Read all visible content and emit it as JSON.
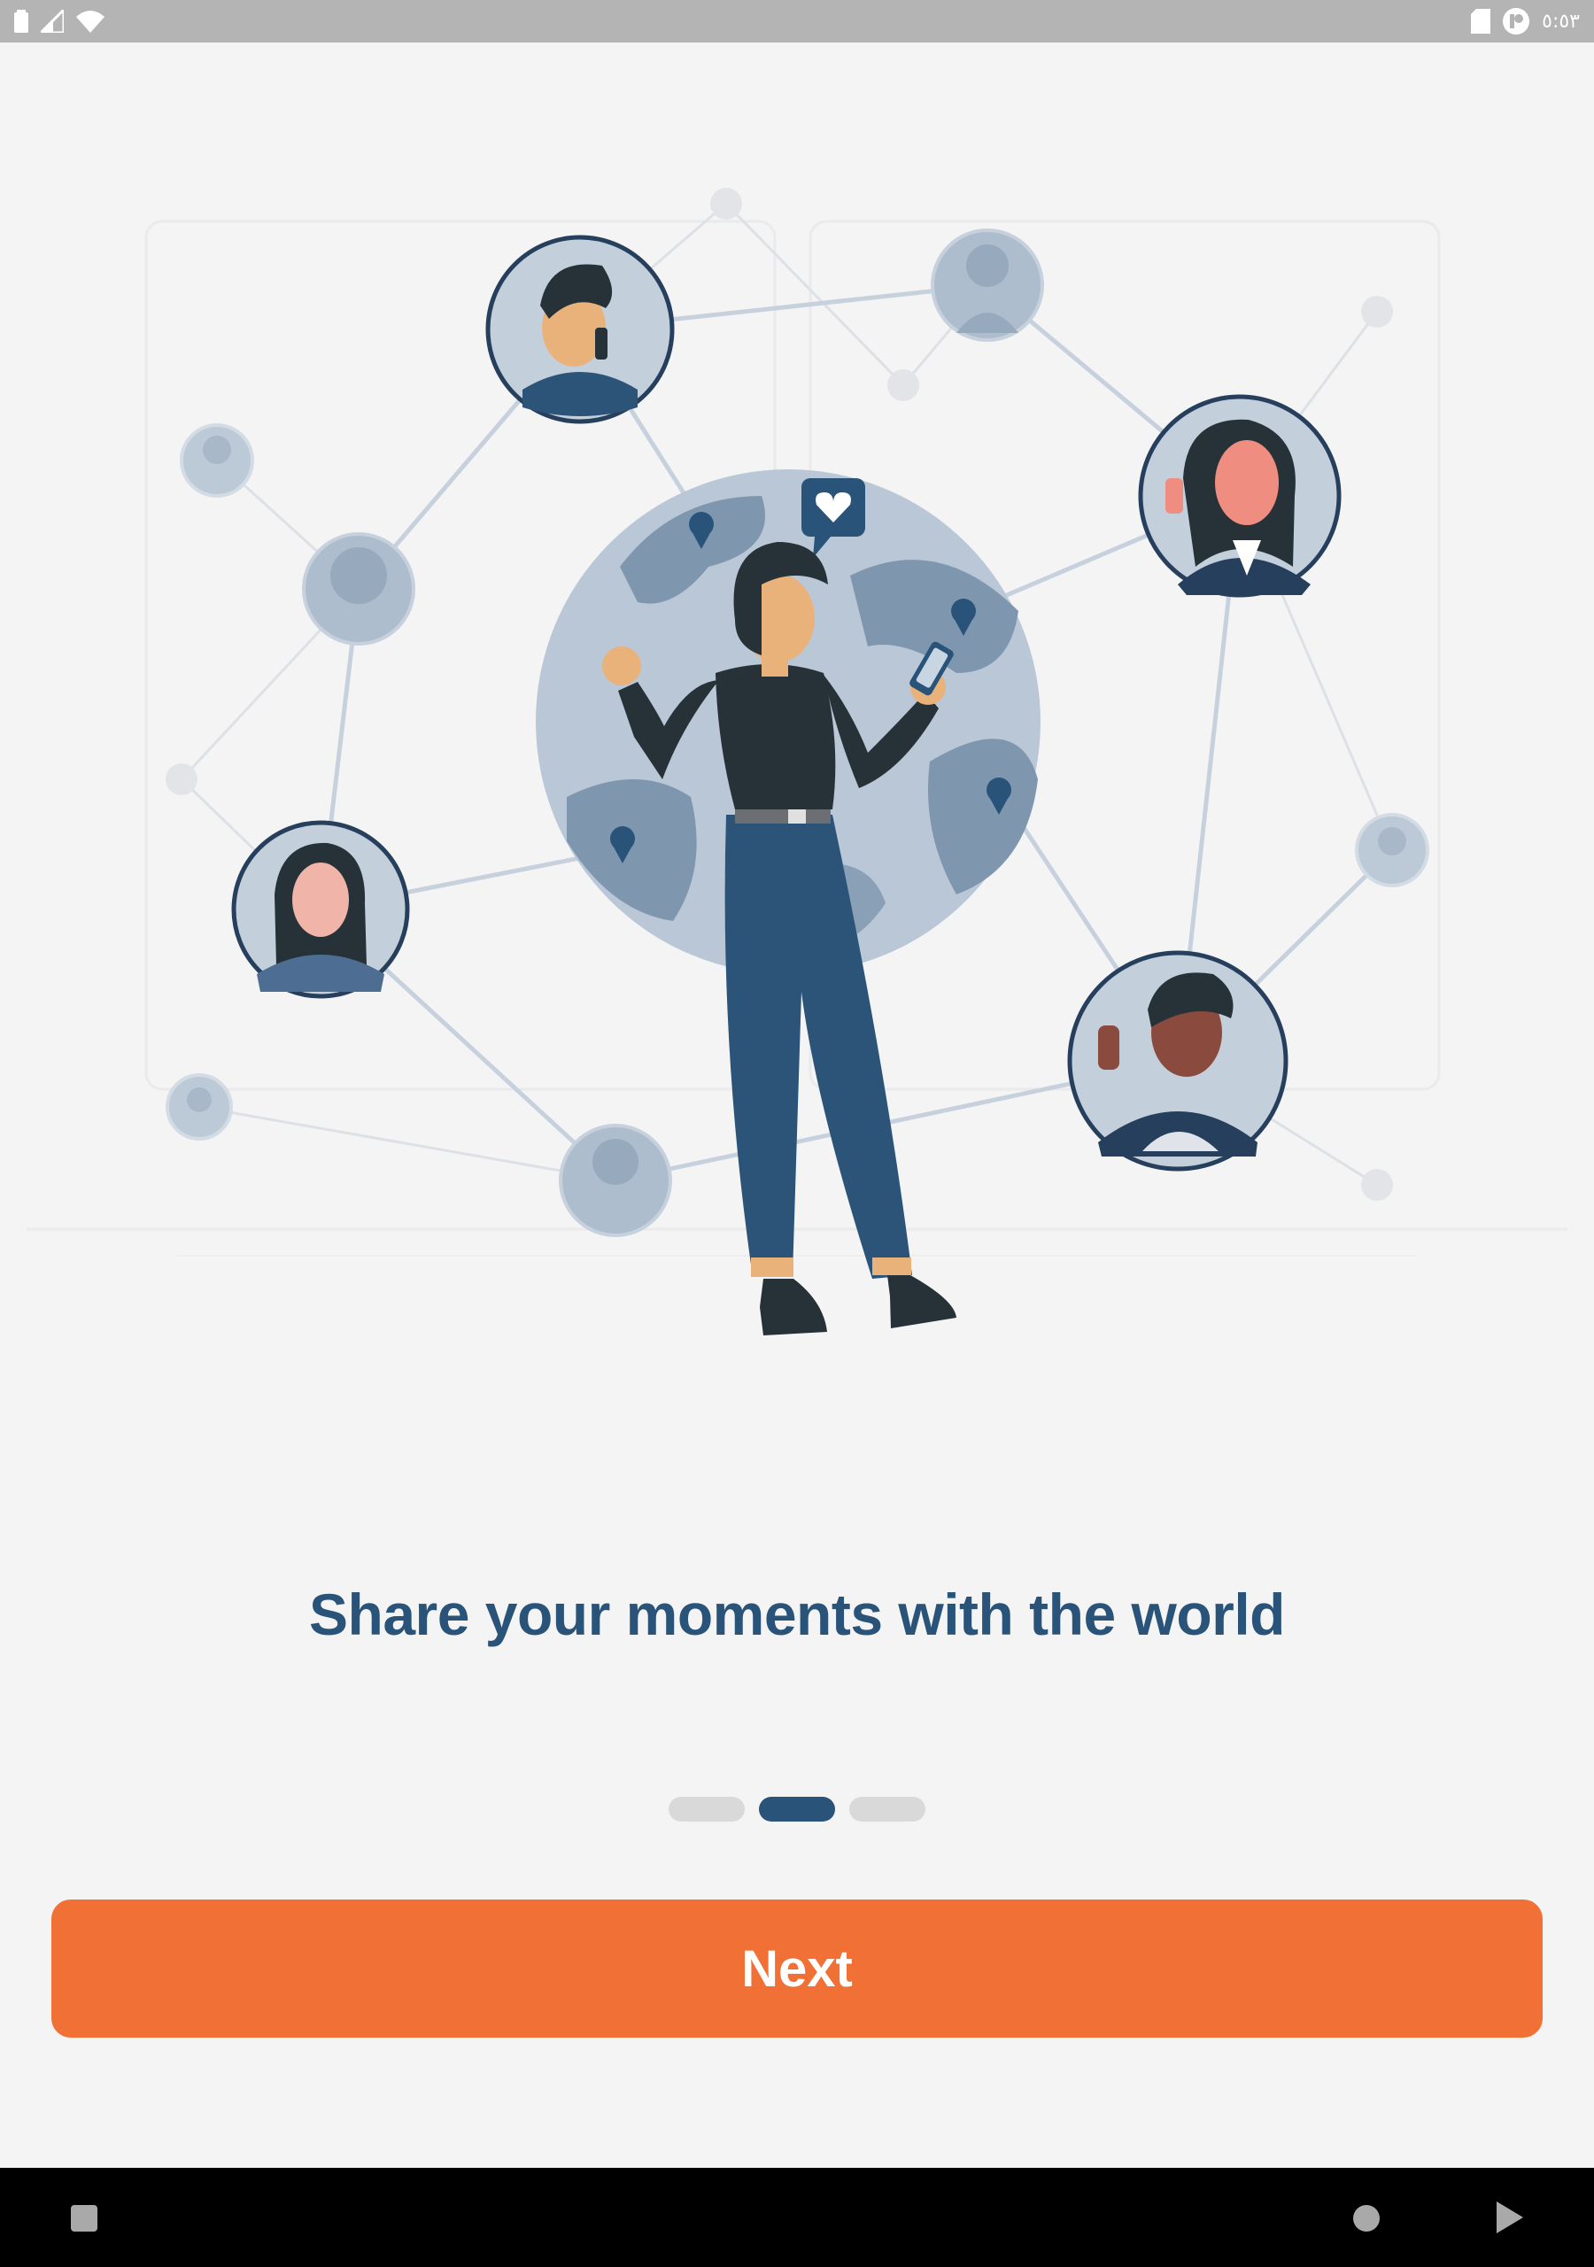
{
  "status_bar": {
    "time": "٥:٥٣",
    "icons": [
      "battery-icon",
      "signal-icon",
      "wifi-icon",
      "sd-card-icon",
      "app-notification-icon"
    ]
  },
  "onboarding": {
    "title": "Share your moments with the world",
    "page_indicator": {
      "count": 3,
      "active_index": 1
    },
    "next_label": "Next"
  },
  "colors": {
    "primary": "#2a5379",
    "accent": "#f07036",
    "background": "#f4f4f4"
  },
  "nav_bar": {
    "icons": [
      "back-icon",
      "home-icon",
      "recents-icon"
    ]
  }
}
